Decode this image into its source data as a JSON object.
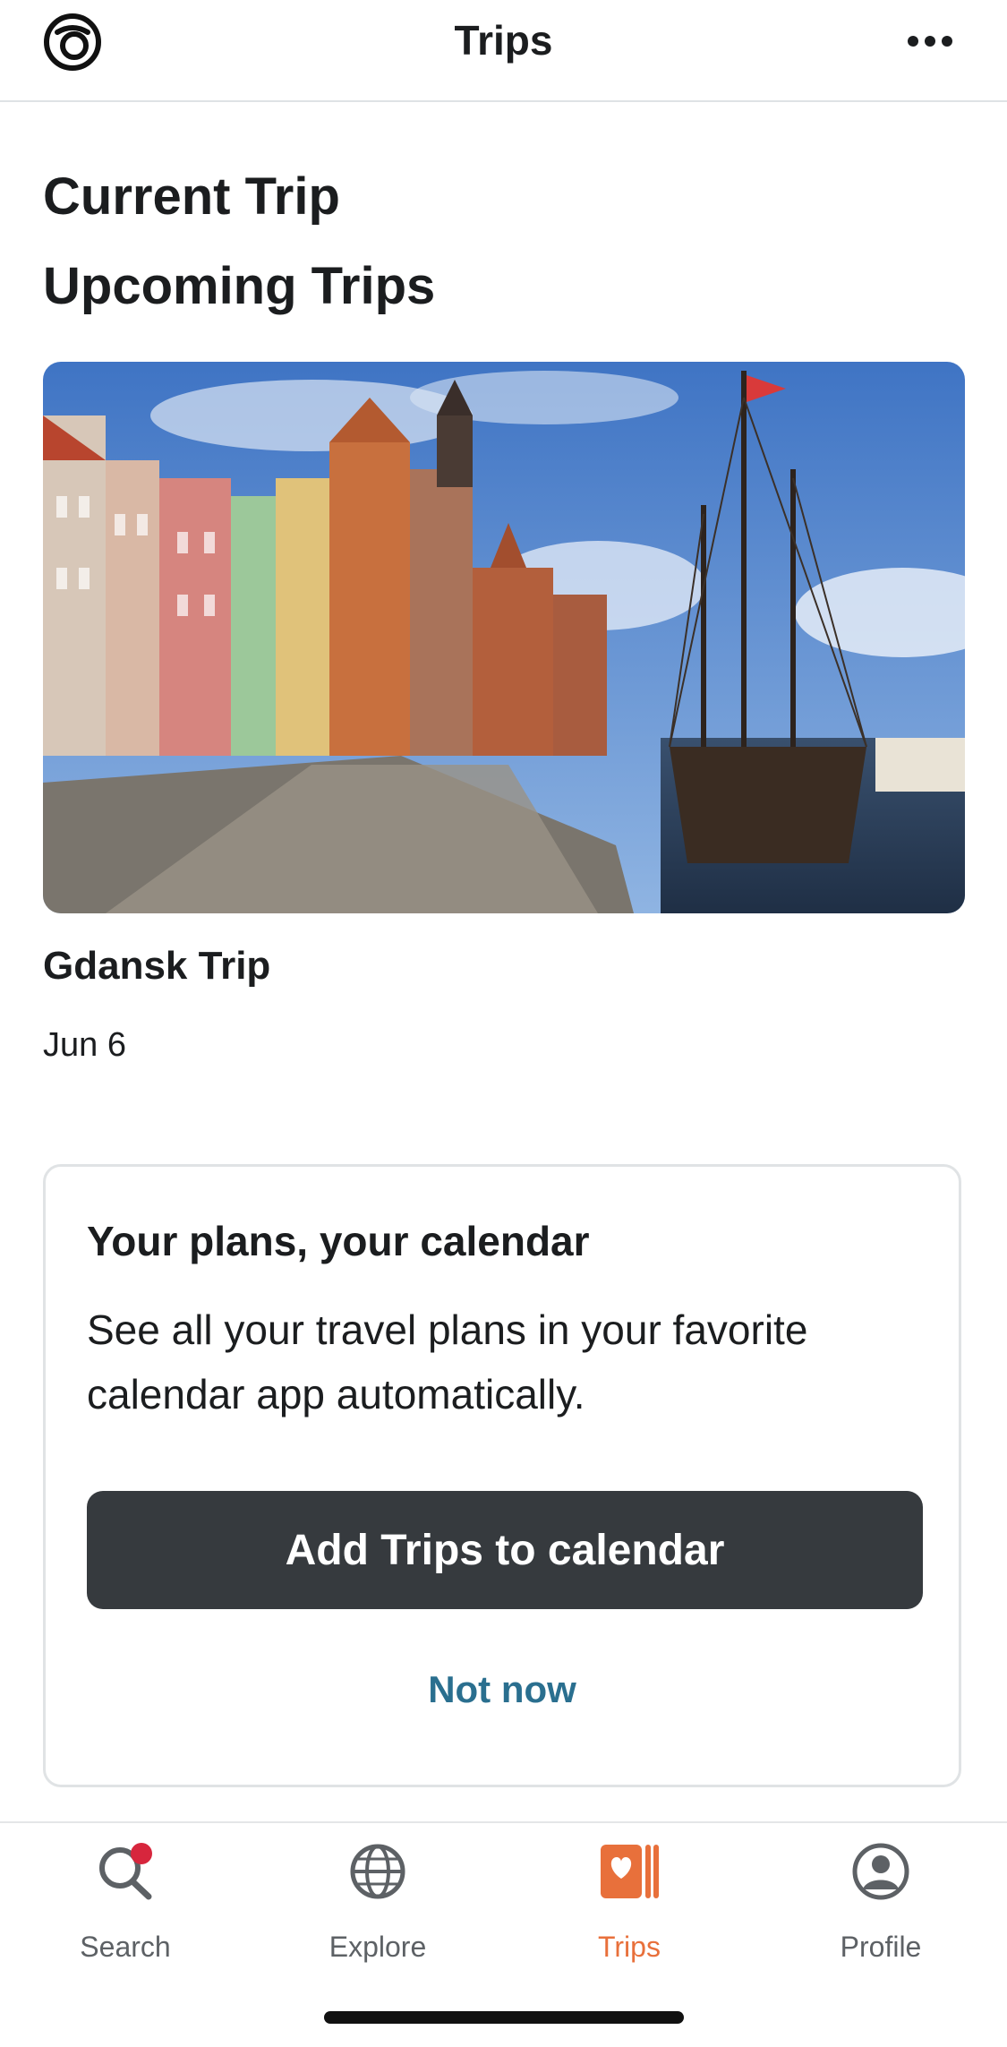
{
  "header": {
    "title": "Trips",
    "logo_icon": "tripadvisor-logo-icon",
    "menu_icon": "more-dots-icon"
  },
  "sections": {
    "current": "Current Trip",
    "upcoming": "Upcoming Trips"
  },
  "trip": {
    "name": "Gdansk Trip",
    "date": "Jun 6",
    "image": "gdansk-waterfront-photo"
  },
  "calendar_card": {
    "title": "Your plans, your calendar",
    "description": "See all your travel plans in your favorite calendar app automatically.",
    "primary_button": "Add Trips to calendar",
    "secondary_link": "Not now"
  },
  "tabs": [
    {
      "label": "Search",
      "icon": "search-icon",
      "badge": true
    },
    {
      "label": "Explore",
      "icon": "globe-icon"
    },
    {
      "label": "Trips",
      "icon": "trips-heart-icon",
      "active": true
    },
    {
      "label": "Profile",
      "icon": "profile-icon"
    }
  ],
  "colors": {
    "accent": "#e8703b",
    "link": "#2a6f8f",
    "button": "#363a3e",
    "badge": "#d7263d"
  }
}
